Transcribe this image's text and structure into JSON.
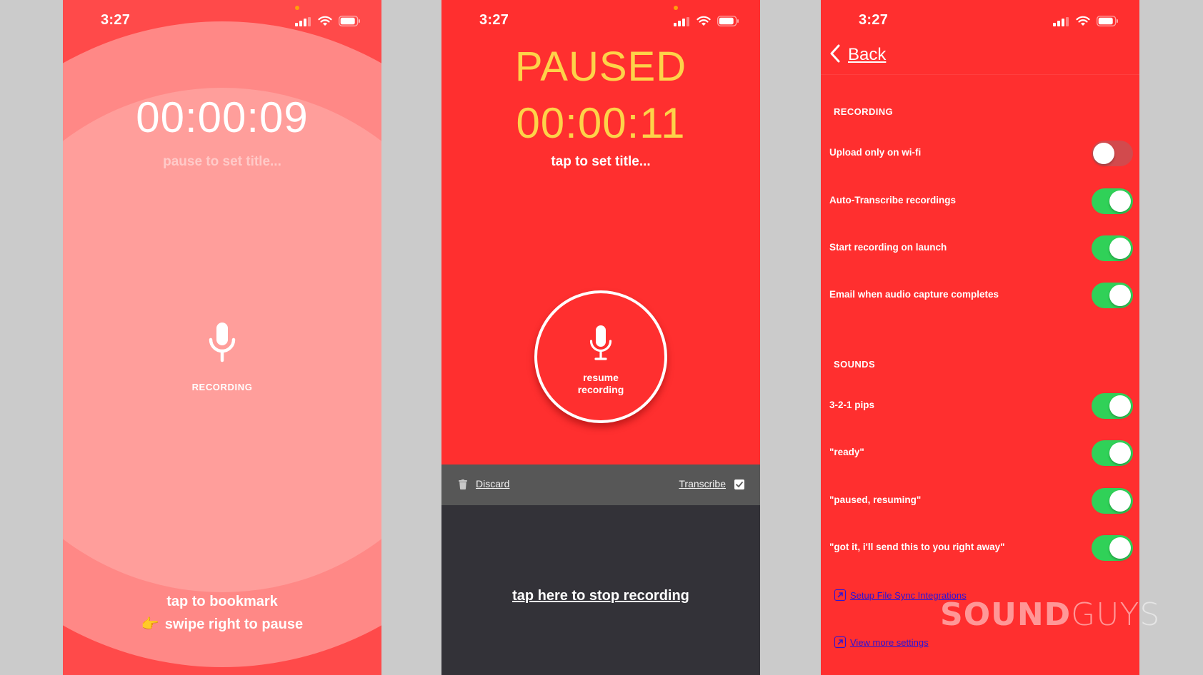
{
  "status_bar": {
    "time": "3:27"
  },
  "screen_recording": {
    "timer": "00:00:09",
    "subtitle": "pause to set title...",
    "mic_label": "RECORDING",
    "hint_bookmark": "tap to bookmark",
    "hint_pause_emoji": "👉",
    "hint_pause": "swipe right to pause"
  },
  "screen_paused": {
    "status": "PAUSED",
    "timer": "00:00:11",
    "subtitle": "tap to set title...",
    "resume_label_1": "resume",
    "resume_label_2": "recording",
    "discard_label": "Discard",
    "transcribe_label": "Transcribe",
    "transcribe_checked": true,
    "stop_label": "tap here to stop recording"
  },
  "screen_settings": {
    "back_label": "Back",
    "sections": [
      {
        "title": "RECORDING",
        "items": [
          {
            "label": "Upload only on wi-fi",
            "on": false
          },
          {
            "label": "Auto-Transcribe recordings",
            "on": true
          },
          {
            "label": "Start recording on launch",
            "on": true
          },
          {
            "label": "Email when audio capture completes",
            "on": true
          }
        ]
      },
      {
        "title": "SOUNDS",
        "items": [
          {
            "label": "3-2-1 pips",
            "on": true
          },
          {
            "label": "\"ready\"",
            "on": true
          },
          {
            "label": "\"paused, resuming\"",
            "on": true
          },
          {
            "label": "\"got it, i'll send this to you right away\"",
            "on": true
          }
        ]
      }
    ],
    "links": [
      {
        "label": "Setup File Sync Integrations"
      },
      {
        "label": "View more settings"
      }
    ]
  },
  "watermark": {
    "bold": "SOUND",
    "light": "GUYS"
  },
  "colors": {
    "accent_red": "#ff2f2f",
    "paused_yellow": "#fdd349",
    "toggle_on": "#30d158",
    "link_blue": "#2a13d8"
  }
}
